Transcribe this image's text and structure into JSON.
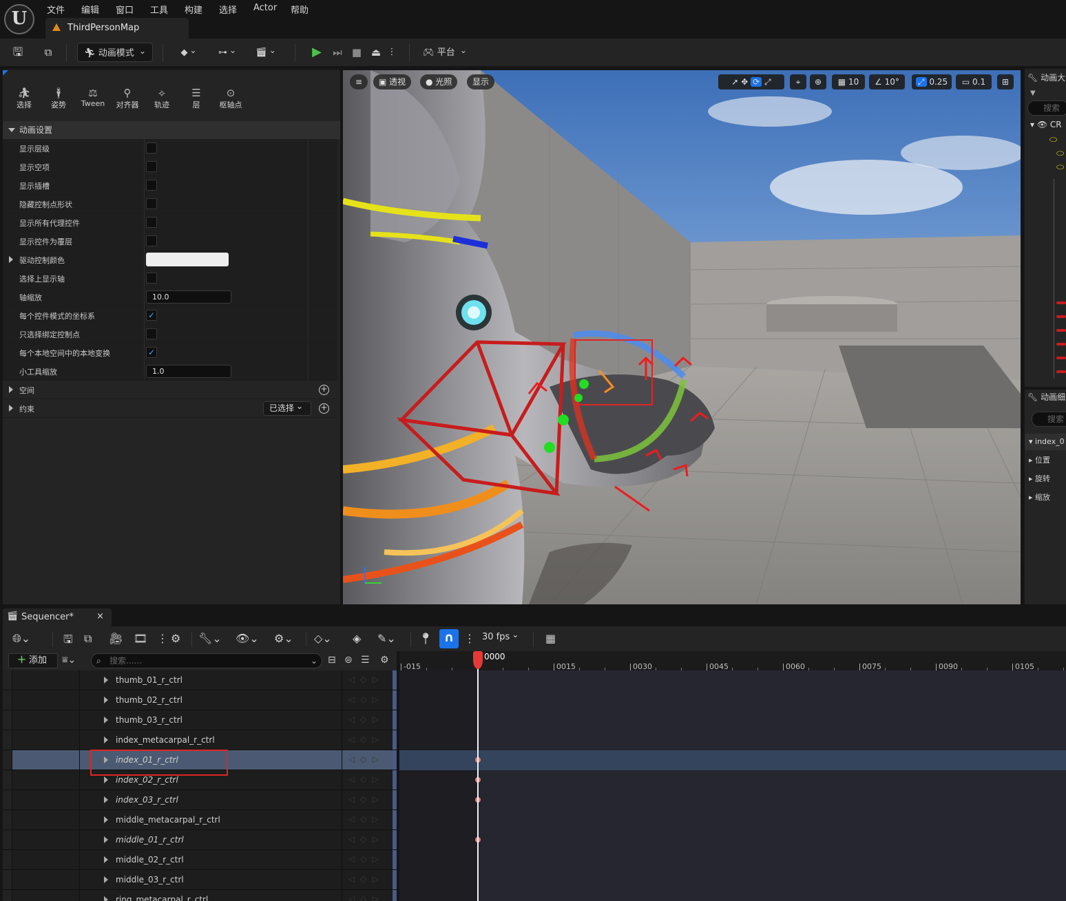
{
  "menu": [
    "文件",
    "编辑",
    "窗口",
    "工具",
    "构建",
    "选择",
    "Actor",
    "帮助"
  ],
  "map_tab": "ThirdPersonMap",
  "toolbar": {
    "mode_label": "动画模式",
    "platform_label": "平台"
  },
  "mode_tools": [
    {
      "label": "选择",
      "icon": "select-icon"
    },
    {
      "label": "姿势",
      "icon": "pose-icon"
    },
    {
      "label": "Tween",
      "icon": "tween-icon"
    },
    {
      "label": "对齐器",
      "icon": "aligner-icon"
    },
    {
      "label": "轨迹",
      "icon": "trail-icon"
    },
    {
      "label": "层",
      "icon": "layer-icon"
    },
    {
      "label": "枢轴点",
      "icon": "pivot-icon"
    }
  ],
  "anim_settings": {
    "header": "动画设置",
    "rows": [
      {
        "label": "显示层级",
        "type": "check",
        "checked": false
      },
      {
        "label": "显示空项",
        "type": "check",
        "checked": false
      },
      {
        "label": "显示插槽",
        "type": "check",
        "checked": false
      },
      {
        "label": "隐藏控制点形状",
        "type": "check",
        "checked": false
      },
      {
        "label": "显示所有代理控件",
        "type": "check",
        "checked": false
      },
      {
        "label": "显示控件为覆层",
        "type": "check",
        "checked": false
      },
      {
        "label": "驱动控制颜色",
        "type": "color",
        "expandable": true
      },
      {
        "label": "选择上显示轴",
        "type": "check",
        "checked": false
      },
      {
        "label": "轴缩放",
        "type": "text",
        "value": "10.0"
      },
      {
        "label": "每个控件模式的坐标系",
        "type": "check",
        "checked": true
      },
      {
        "label": "只选择绑定控制点",
        "type": "check",
        "checked": false
      },
      {
        "label": "每个本地空间中的本地变换",
        "type": "check",
        "checked": true
      },
      {
        "label": "小工具缩放",
        "type": "text",
        "value": "1.0"
      }
    ],
    "space_label": "空间",
    "constraint_label": "约束",
    "constraint_dropdown": "已选择"
  },
  "viewport": {
    "menu_icon": "≡",
    "perspective": "透视",
    "lighting": "光照",
    "show": "显示",
    "grid_snap": "10",
    "rot_snap": "10°",
    "scale_snap": "0.25",
    "camera_speed": "0.1"
  },
  "right_panel": {
    "top_title": "动画大",
    "search": "搜索",
    "root_item": "CR",
    "bottom_title": "动画细",
    "search2": "搜索",
    "selected_item": "index_0",
    "props": [
      "位置",
      "旋转",
      "缩放"
    ]
  },
  "sequencer": {
    "tab_label": "Sequencer*",
    "fps": "30 fps",
    "add_label": "添加",
    "search_placeholder": "搜索......",
    "playhead_frame": "0000",
    "ticks": [
      "-015",
      "0015",
      "0030",
      "0045",
      "0060",
      "0075",
      "0090",
      "0105"
    ],
    "tracks": [
      {
        "name": "thumb_01_r_ctrl",
        "italic": false,
        "selected": false,
        "key": false
      },
      {
        "name": "thumb_02_r_ctrl",
        "italic": false,
        "selected": false,
        "key": false
      },
      {
        "name": "thumb_03_r_ctrl",
        "italic": false,
        "selected": false,
        "key": false
      },
      {
        "name": "index_metacarpal_r_ctrl",
        "italic": false,
        "selected": false,
        "key": false
      },
      {
        "name": "index_01_r_ctrl",
        "italic": true,
        "selected": true,
        "key": true
      },
      {
        "name": "index_02_r_ctrl",
        "italic": true,
        "selected": false,
        "key": true
      },
      {
        "name": "index_03_r_ctrl",
        "italic": true,
        "selected": false,
        "key": true
      },
      {
        "name": "middle_metacarpal_r_ctrl",
        "italic": false,
        "selected": false,
        "key": false
      },
      {
        "name": "middle_01_r_ctrl",
        "italic": true,
        "selected": false,
        "key": true
      },
      {
        "name": "middle_02_r_ctrl",
        "italic": false,
        "selected": false,
        "key": false
      },
      {
        "name": "middle_03_r_ctrl",
        "italic": false,
        "selected": false,
        "key": false
      },
      {
        "name": "ring_metacarpal_r_ctrl",
        "italic": false,
        "selected": false,
        "key": false
      }
    ]
  },
  "colors": {
    "accent": "#1a73e8",
    "highlight_box": "#e02424",
    "playhead": "#e53935"
  }
}
